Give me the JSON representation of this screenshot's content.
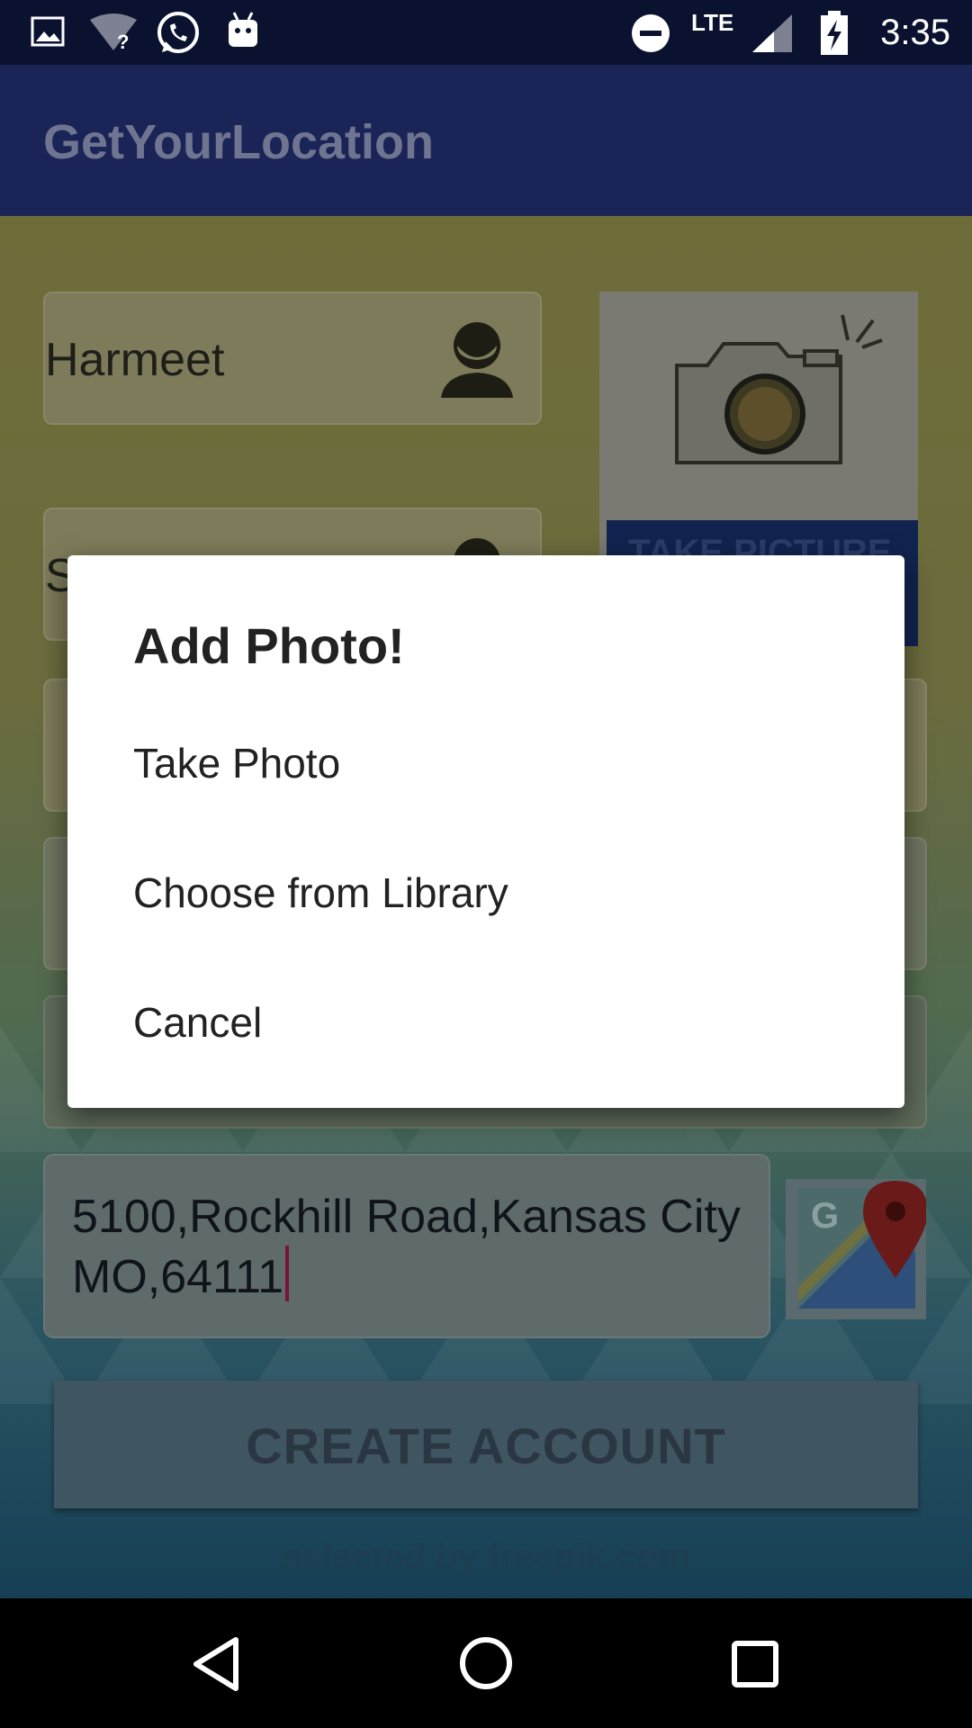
{
  "status_bar": {
    "time": "3:35",
    "network": "LTE",
    "icons": [
      "image-icon",
      "wifi-unknown-icon",
      "whatsapp-icon",
      "android-debug-icon",
      "do-not-disturb-icon",
      "signal-icon",
      "battery-charging-icon"
    ]
  },
  "app": {
    "title": "GetYourLocation"
  },
  "form": {
    "first_name": "Harmeet",
    "last_name_partial": "S",
    "take_picture_label": "TAKE PICTURE",
    "address_line1": "5100,Rockhill Road,Kansas City",
    "address_line2": "MO,64111",
    "create_account_label": "CREATE ACCOUNT",
    "attribution": "selected by freepik.com"
  },
  "dialog": {
    "title": "Add Photo!",
    "options": [
      "Take Photo",
      "Choose from Library",
      "Cancel"
    ]
  },
  "nav_bar": {
    "buttons": [
      "back-icon",
      "home-icon",
      "recents-icon"
    ]
  },
  "colors": {
    "app_bar": "#1b2456",
    "status_bar": "#0b1230",
    "cursor": "#7a1239"
  }
}
